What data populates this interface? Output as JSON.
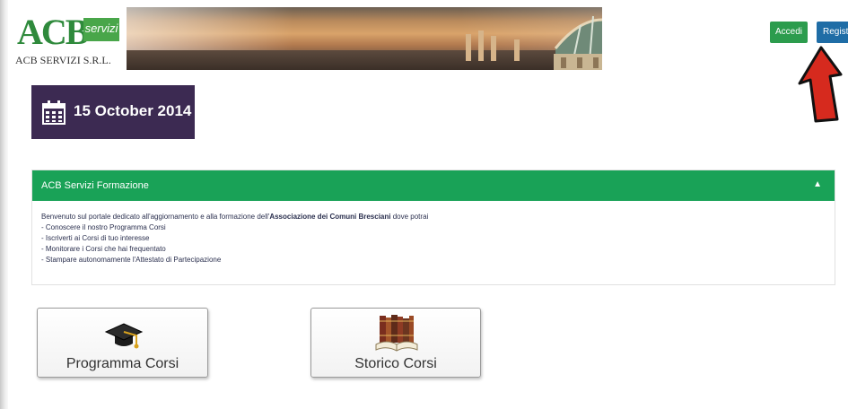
{
  "header": {
    "logo_text": "ACB",
    "logo_badge": "servizi",
    "company_name": "ACB SERVIZI S.R.L.",
    "login_label": "Accedi",
    "register_label": "Registrati"
  },
  "date_card": {
    "icon": "calendar-icon",
    "date": "15 October 2014"
  },
  "panel": {
    "title": "ACB Servizi Formazione",
    "collapse_icon": "chevron-up-icon",
    "intro_prefix": "Benvenuto sul portale dedicato all'aggiornamento e alla formazione dell'",
    "intro_bold": "Associazione dei Comuni Bresciani",
    "intro_suffix": " dove potrai",
    "items": [
      "- Conoscere il nostro Programma Corsi",
      "- Iscriverti ai Corsi di tuo interesse",
      "- Monitorare i Corsi che hai frequentato",
      "- Stampare autonomamente l'Attestato di Partecipazione"
    ]
  },
  "tiles": [
    {
      "label": "Programma Corsi",
      "icon": "graduation-cap-icon"
    },
    {
      "label": "Storico Corsi",
      "icon": "books-icon"
    }
  ],
  "colors": {
    "green": "#19a257",
    "blue": "#1f6da6",
    "purple": "#3c2a52",
    "arrow_red": "#d62a1e"
  }
}
